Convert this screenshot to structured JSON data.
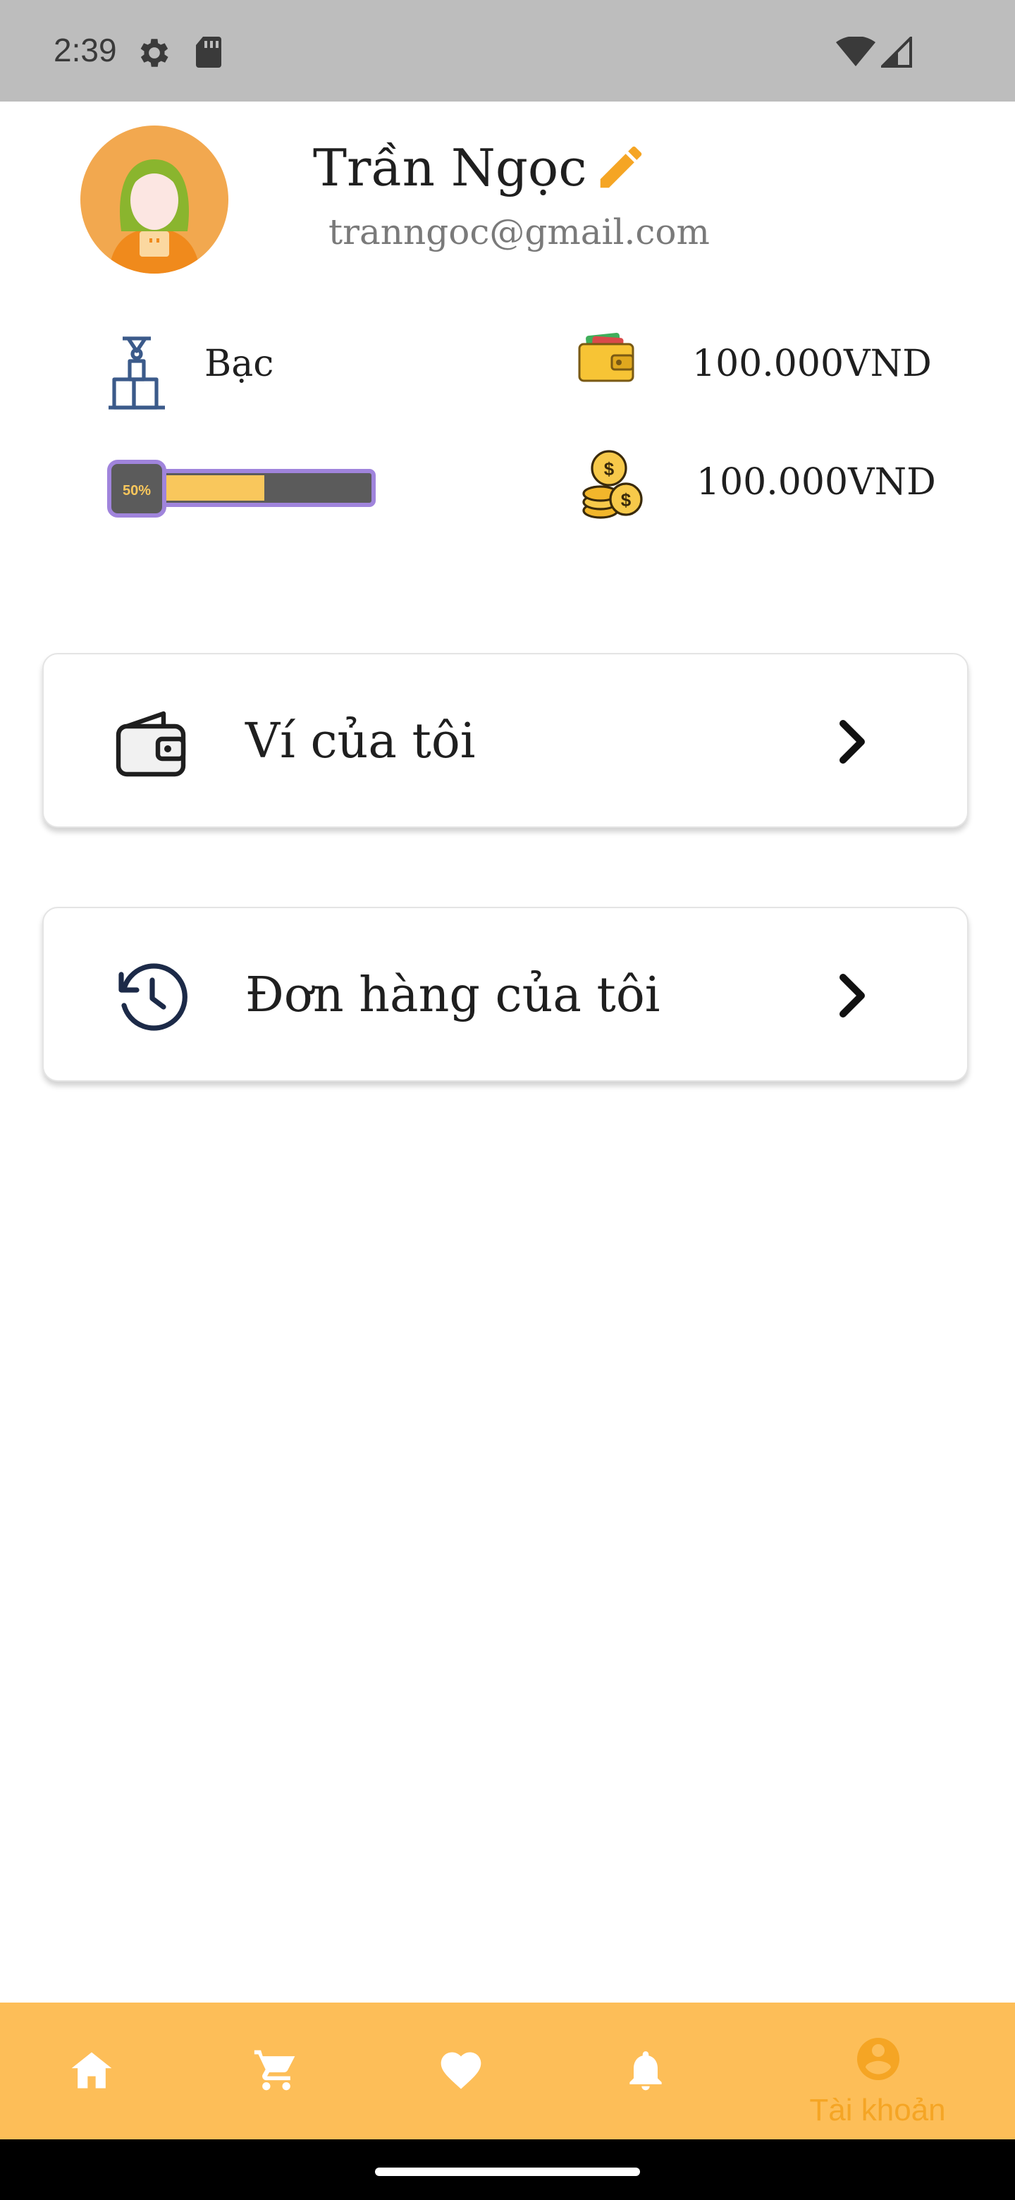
{
  "status_bar": {
    "time": "2:39",
    "icons": [
      "gear-icon",
      "sd-card-icon",
      "wifi-icon",
      "signal-icon"
    ]
  },
  "profile": {
    "name": "Trần Ngọc",
    "email": "tranngoc@gmail.com",
    "edit_icon": "pencil-icon"
  },
  "stats": {
    "rank": "Bạc",
    "rank_progress_label": "50%",
    "rank_progress": 0.5,
    "wallet_balance": "100.000VND",
    "coin_balance": "100.000VND"
  },
  "menu": [
    {
      "label": "Ví của tôi",
      "icon": "wallet-icon"
    },
    {
      "label": "Đơn hàng của tôi",
      "icon": "history-icon"
    }
  ],
  "bottom_nav": {
    "items": [
      "home-icon",
      "cart-icon",
      "heart-icon",
      "bell-icon",
      "account-icon"
    ],
    "active_label": "Tài khoản"
  },
  "colors": {
    "accent": "#fdbe58",
    "active": "#f5a524",
    "status_bar": "#bdbdbd",
    "progress_border": "#a084dc",
    "progress_fill": "#f9c75c"
  }
}
